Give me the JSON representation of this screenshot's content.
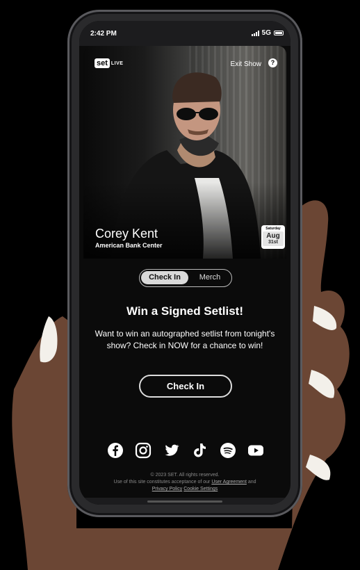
{
  "status": {
    "time": "2:42 PM",
    "network": "5G"
  },
  "header": {
    "logo_text": "set",
    "logo_live": "LIVE",
    "exit_label": "Exit Show",
    "help_glyph": "?"
  },
  "event": {
    "artist": "Corey Kent",
    "venue": "American Bank Center",
    "day_of_week": "Saturday",
    "month": "Aug",
    "day": "31st"
  },
  "tabs": {
    "active": "Check In",
    "inactive": "Merch"
  },
  "promo": {
    "title": "Win a Signed Setlist!",
    "description": "Want to win an autographed setlist from tonight's show? Check in NOW for a chance to win!",
    "button_label": "Check In"
  },
  "socials": [
    "facebook-icon",
    "instagram-icon",
    "twitter-icon",
    "tiktok-icon",
    "spotify-icon",
    "youtube-icon"
  ],
  "footer": {
    "copyright": "© 2023 SET. All rights reserved.",
    "terms_prefix": "Use of this site constitutes acceptance of our",
    "user_agreement": "User Agreement",
    "and": "and",
    "privacy": "Privacy Policy",
    "cookie": "Cookie Settings"
  },
  "colors": {
    "background": "#000000",
    "button_border": "#dddddd",
    "toggle_active": "#d9d9d9"
  }
}
